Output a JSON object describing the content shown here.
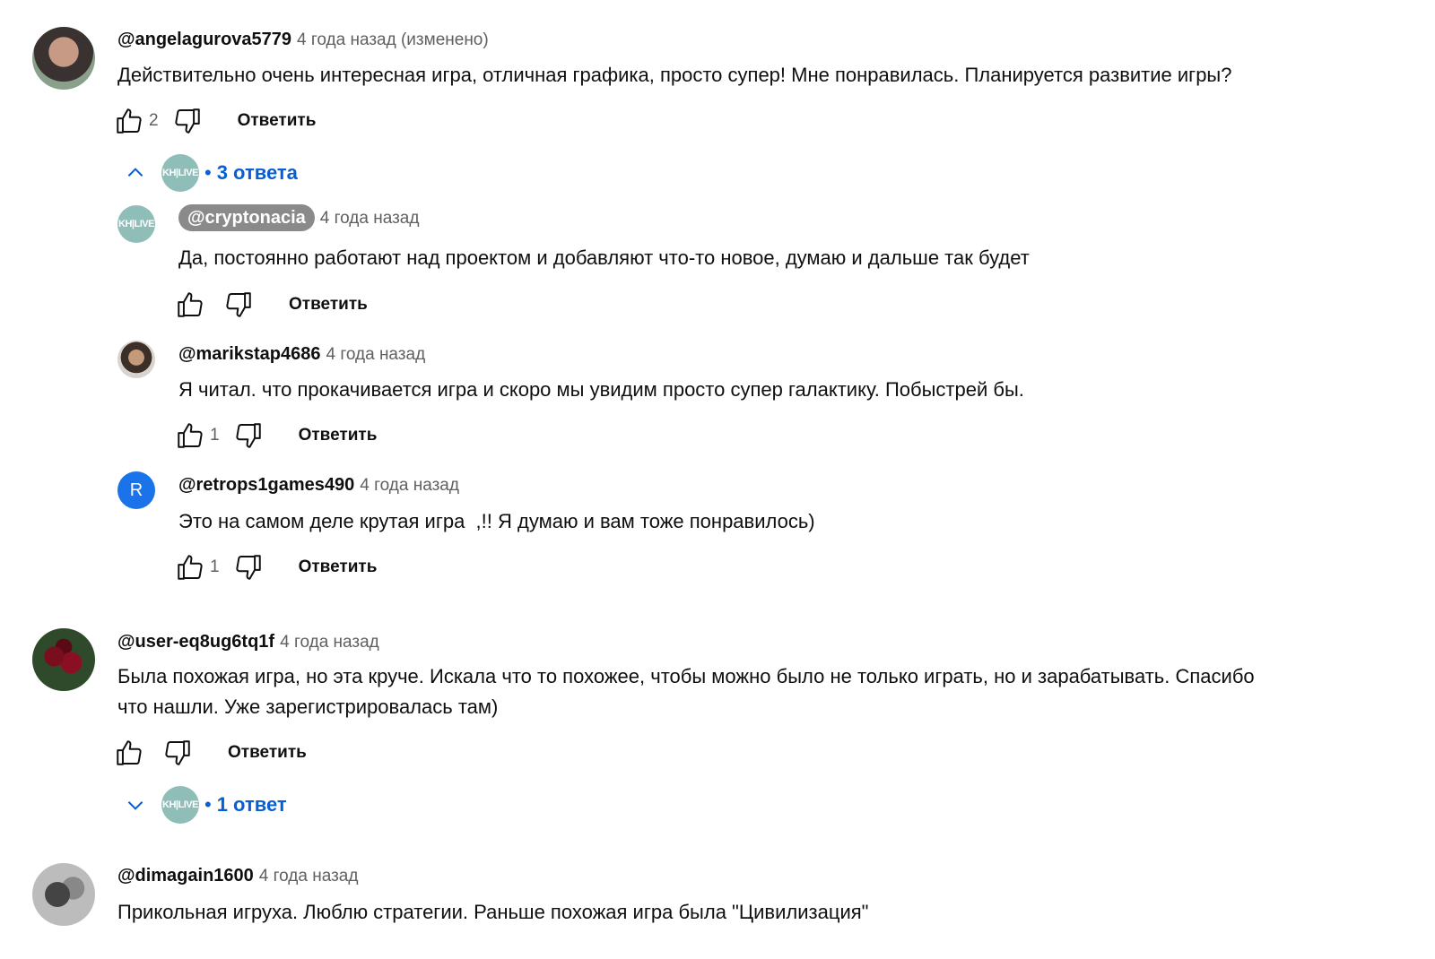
{
  "comments": [
    {
      "author": "@angelagurova5779",
      "time": "4 года назад (изменено)",
      "text": "Действительно очень интересная игра, отличная графика, просто супер! Мне понравилась. Планируется развитие игры?",
      "likes": "2",
      "reply_label": "Ответить",
      "replies_toggle": "3 ответа"
    },
    {
      "author": "@user-eq8ug6tq1f",
      "time": "4 года назад",
      "text_line1": "Была похожая игра, но эта круче. Искала что то похожее, чтобы можно было не только играть, но и зарабатывать. Спасибо",
      "text_line2": "что нашли. Уже зарегистрировалась там)",
      "reply_label": "Ответить",
      "replies_toggle": "1 ответ"
    },
    {
      "author": "@dimagain1600",
      "time": "4 года назад",
      "text": "Прикольная игруха. Люблю стратегии. Раньше похожая игра была \"Цивилизация\""
    }
  ],
  "replies": [
    {
      "author": "@cryptonacia",
      "time": "4 года назад",
      "text": "Да, постоянно работают над проектом и добавляют что-то новое, думаю и дальше так будет",
      "reply_label": "Ответить"
    },
    {
      "author": "@marikstap4686",
      "time": "4 года назад",
      "text": "Я читал. что прокачивается игра и скоро мы увидим просто супер галактику. Побыстрей бы.",
      "likes": "1",
      "reply_label": "Ответить"
    },
    {
      "author": "@retrops1games490",
      "time": "4 года назад",
      "text": "Это на самом деле крутая игра  ,!! Я думаю и вам тоже понравилось)",
      "likes": "1",
      "reply_label": "Ответить",
      "avatar_letter": "R"
    }
  ],
  "channel_logo_text": "KH|LIVE",
  "colors": {
    "link": "#065fd4",
    "muted": "#606060",
    "chip": "#8a8a8a",
    "retro_avatar": "#1a73e8"
  }
}
